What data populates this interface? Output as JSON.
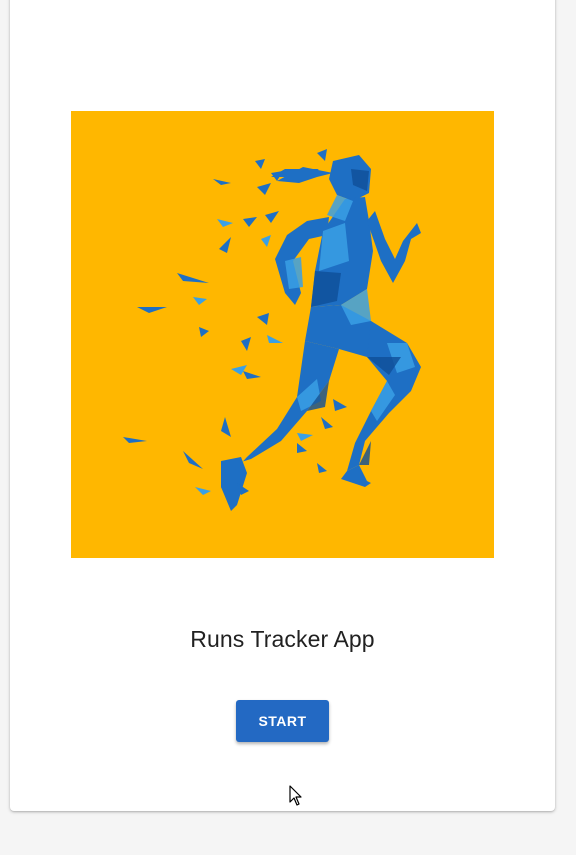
{
  "app": {
    "title": "Runs Tracker App",
    "start_label": "START"
  },
  "hero": {
    "icon": "low-poly-runner-illustration",
    "background_color": "#ffb700",
    "figure_color": "#1e6fc4"
  },
  "colors": {
    "accent": "#2369c3",
    "page_background": "#f5f5f5",
    "card_background": "#ffffff"
  }
}
